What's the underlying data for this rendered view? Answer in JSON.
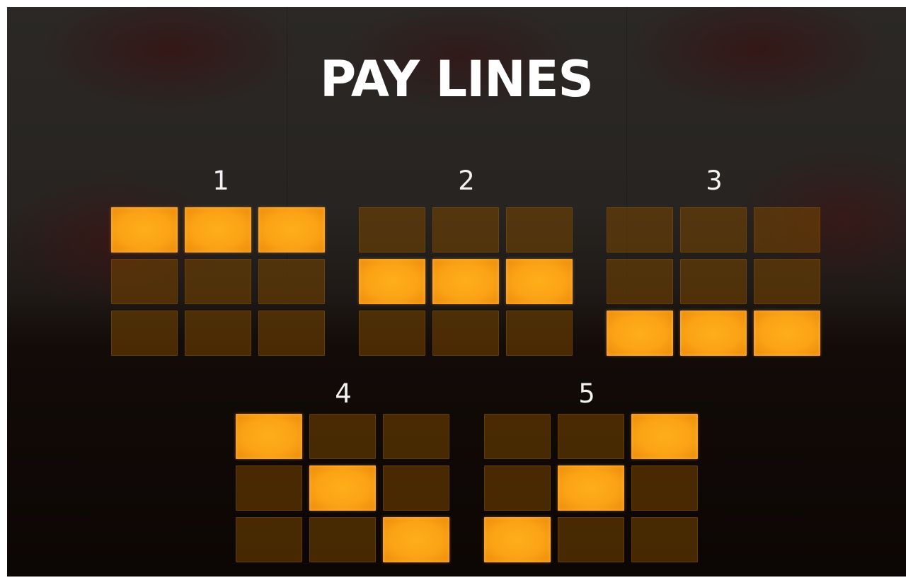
{
  "title": "PAY LINES",
  "colors": {
    "lit_cell": "#fba316",
    "unlit_cell": "#6b3e08",
    "title_text": "#ffffff",
    "number_text": "#f2f2f2"
  },
  "paylines": [
    {
      "number": "1",
      "pattern": [
        [
          1,
          1,
          1
        ],
        [
          0,
          0,
          0
        ],
        [
          0,
          0,
          0
        ]
      ]
    },
    {
      "number": "2",
      "pattern": [
        [
          0,
          0,
          0
        ],
        [
          1,
          1,
          1
        ],
        [
          0,
          0,
          0
        ]
      ]
    },
    {
      "number": "3",
      "pattern": [
        [
          0,
          0,
          0
        ],
        [
          0,
          0,
          0
        ],
        [
          1,
          1,
          1
        ]
      ]
    },
    {
      "number": "4",
      "pattern": [
        [
          1,
          0,
          0
        ],
        [
          0,
          1,
          0
        ],
        [
          0,
          0,
          1
        ]
      ]
    },
    {
      "number": "5",
      "pattern": [
        [
          0,
          0,
          1
        ],
        [
          0,
          1,
          0
        ],
        [
          1,
          0,
          0
        ]
      ]
    }
  ]
}
